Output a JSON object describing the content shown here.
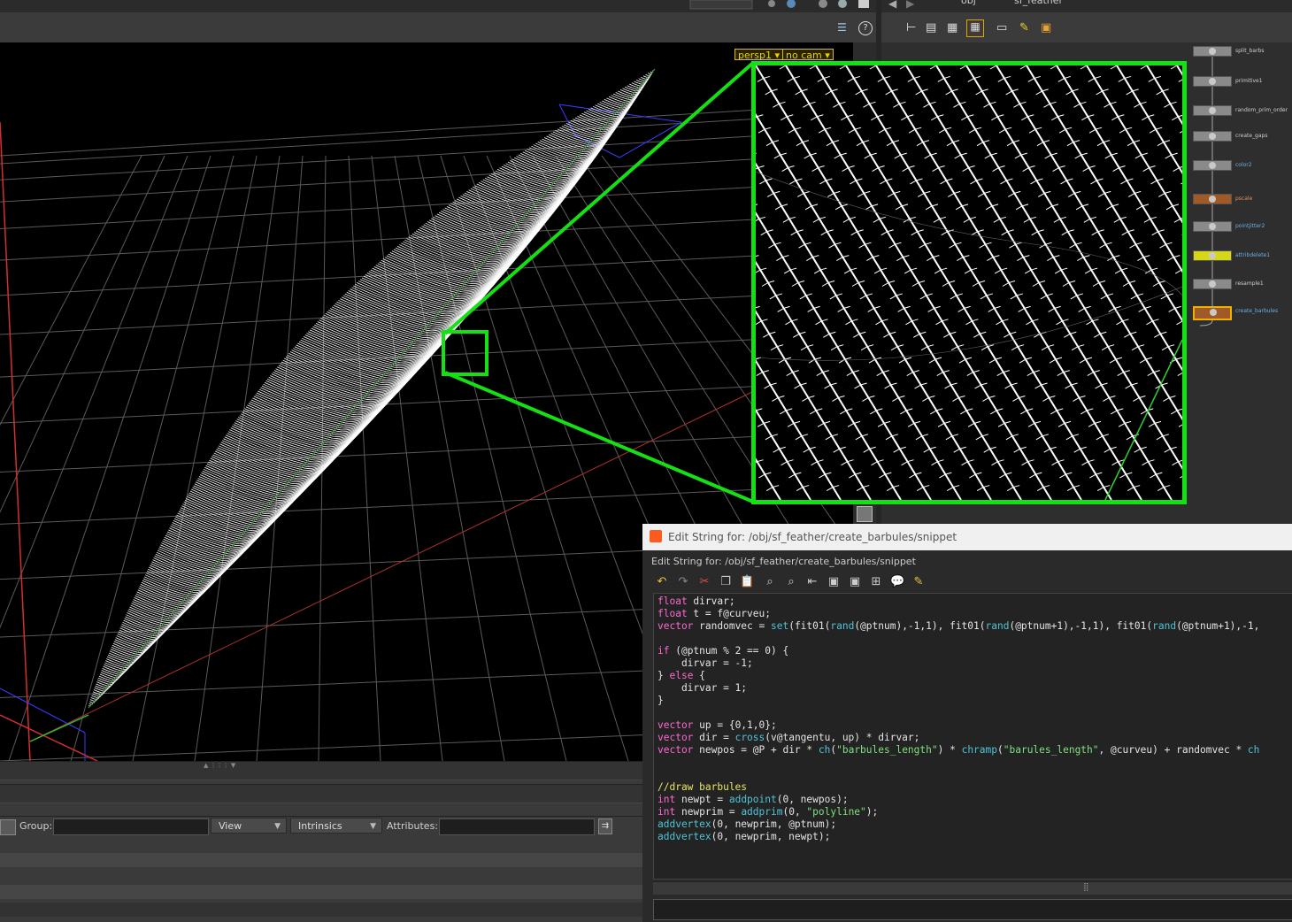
{
  "viewer": {
    "camera": "persp1",
    "camera_mode": "no cam"
  },
  "network": {
    "path_root": "obj",
    "path_node": "sf_feather",
    "nodes": [
      {
        "name": "split_barbs",
        "color": "gray",
        "label_color": "gray"
      },
      {
        "name": "primitive1",
        "color": "gray",
        "label_color": "gray"
      },
      {
        "name": "random_prim_order",
        "color": "gray",
        "label_color": "gray"
      },
      {
        "name": "create_gaps",
        "color": "gray",
        "label_color": "gray"
      },
      {
        "name": "color2",
        "color": "gray",
        "label_color": "blue"
      },
      {
        "name": "pscale",
        "color": "orange",
        "label_color": "orange"
      },
      {
        "name": "pointjitter2",
        "color": "gray",
        "label_color": "blue"
      },
      {
        "name": "attribdelete1",
        "color": "yellow",
        "label_color": "blue"
      },
      {
        "name": "resample1",
        "color": "gray",
        "label_color": "gray"
      },
      {
        "name": "create_barbules",
        "color": "orange",
        "label_color": "blue"
      }
    ]
  },
  "spreadsheet": {
    "group_label": "Group:",
    "view_label": "View",
    "intrinsics_label": "Intrinsics",
    "attributes_label": "Attributes:"
  },
  "editor": {
    "window_title": "Edit String for: /obj/sf_feather/create_barbules/snippet",
    "label": "Edit String for: /obj/sf_feather/create_barbules/snippet",
    "code_lines": [
      [
        {
          "t": "float",
          "c": "kw"
        },
        {
          "t": " dirvar;"
        }
      ],
      [
        {
          "t": "float",
          "c": "kw"
        },
        {
          "t": " t = f@curveu;"
        }
      ],
      [
        {
          "t": "vector",
          "c": "kw"
        },
        {
          "t": " randomvec = "
        },
        {
          "t": "set",
          "c": "fn"
        },
        {
          "t": "(fit01("
        },
        {
          "t": "rand",
          "c": "fn"
        },
        {
          "t": "(@ptnum),-1,1), fit01("
        },
        {
          "t": "rand",
          "c": "fn"
        },
        {
          "t": "(@ptnum+1),-1,1), fit01("
        },
        {
          "t": "rand",
          "c": "fn"
        },
        {
          "t": "(@ptnum+1),-1,"
        }
      ],
      [],
      [
        {
          "t": "if",
          "c": "kw"
        },
        {
          "t": " (@ptnum % 2 == 0) {"
        }
      ],
      [
        {
          "t": "    dirvar = -1;"
        }
      ],
      [
        {
          "t": "} "
        },
        {
          "t": "else",
          "c": "kw"
        },
        {
          "t": " {"
        }
      ],
      [
        {
          "t": "    dirvar = 1;"
        }
      ],
      [
        {
          "t": "}"
        }
      ],
      [],
      [
        {
          "t": "vector",
          "c": "kw"
        },
        {
          "t": " up = {0,1,0};"
        }
      ],
      [
        {
          "t": "vector",
          "c": "kw"
        },
        {
          "t": " dir = "
        },
        {
          "t": "cross",
          "c": "fn"
        },
        {
          "t": "(v@tangentu, up) * dirvar;"
        }
      ],
      [
        {
          "t": "vector",
          "c": "kw"
        },
        {
          "t": " newpos = @P + dir * "
        },
        {
          "t": "ch",
          "c": "fn"
        },
        {
          "t": "("
        },
        {
          "t": "\"barbules_length\"",
          "c": "st"
        },
        {
          "t": ") * "
        },
        {
          "t": "chramp",
          "c": "fn"
        },
        {
          "t": "("
        },
        {
          "t": "\"barules_length\"",
          "c": "st"
        },
        {
          "t": ", @curveu) + randomvec * "
        },
        {
          "t": "ch",
          "c": "fn"
        }
      ],
      [],
      [],
      [
        {
          "t": "//draw barbules",
          "c": "cm"
        }
      ],
      [
        {
          "t": "int",
          "c": "kw"
        },
        {
          "t": " newpt = "
        },
        {
          "t": "addpoint",
          "c": "fn"
        },
        {
          "t": "(0, newpos);"
        }
      ],
      [
        {
          "t": "int",
          "c": "kw"
        },
        {
          "t": " newprim = "
        },
        {
          "t": "addprim",
          "c": "fn"
        },
        {
          "t": "(0, "
        },
        {
          "t": "\"polyline\"",
          "c": "st"
        },
        {
          "t": ");"
        }
      ],
      [
        {
          "t": "addvertex",
          "c": "fn"
        },
        {
          "t": "(0, newprim, @ptnum);"
        }
      ],
      [
        {
          "t": "addvertex",
          "c": "fn"
        },
        {
          "t": "(0, newprim, newpt);"
        }
      ]
    ]
  },
  "colors": {
    "highlight": "#14e014",
    "keyword": "#ff68d0",
    "function": "#4fc4d6",
    "string": "#7ee07e",
    "comment": "#e6e660"
  }
}
